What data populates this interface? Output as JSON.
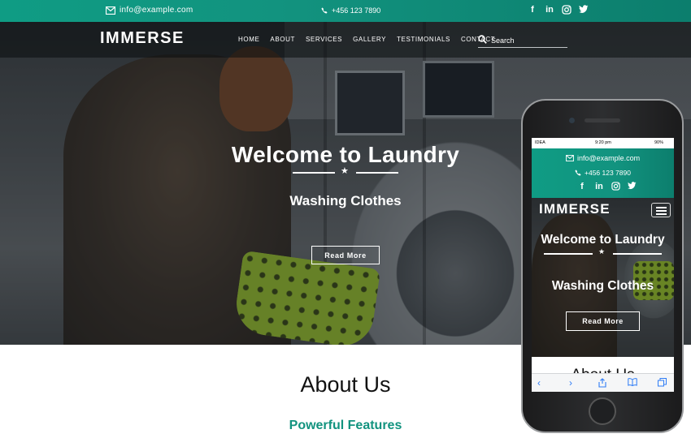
{
  "topbar": {
    "email": "info@example.com",
    "phone": "+456 123 7890",
    "social": [
      "facebook",
      "linkedin",
      "instagram",
      "twitter"
    ]
  },
  "nav": {
    "brand": "IMMERSE",
    "links": [
      "HOME",
      "ABOUT",
      "SERVICES",
      "GALLERY",
      "TESTIMONIALS",
      "CONTACT"
    ],
    "search_placeholder": "Search"
  },
  "hero": {
    "title": "Welcome to Laundry",
    "subtitle": "Washing Clothes",
    "button": "Read More"
  },
  "about": {
    "title": "About Us",
    "subtitle": "Powerful Features"
  },
  "mobile": {
    "status": {
      "carrier": "IDEA",
      "time": "9:20 pm",
      "battery": "90%"
    },
    "email": "info@example.com",
    "phone": "+456 123 7890",
    "brand": "IMMERSE",
    "title": "Welcome to Laundry",
    "subtitle": "Washing Clothes",
    "button": "Read More",
    "about_title": "About Us"
  },
  "colors": {
    "accent": "#12937f",
    "dark_nav": "#0a0c0e",
    "basket": "#9bc42f"
  }
}
